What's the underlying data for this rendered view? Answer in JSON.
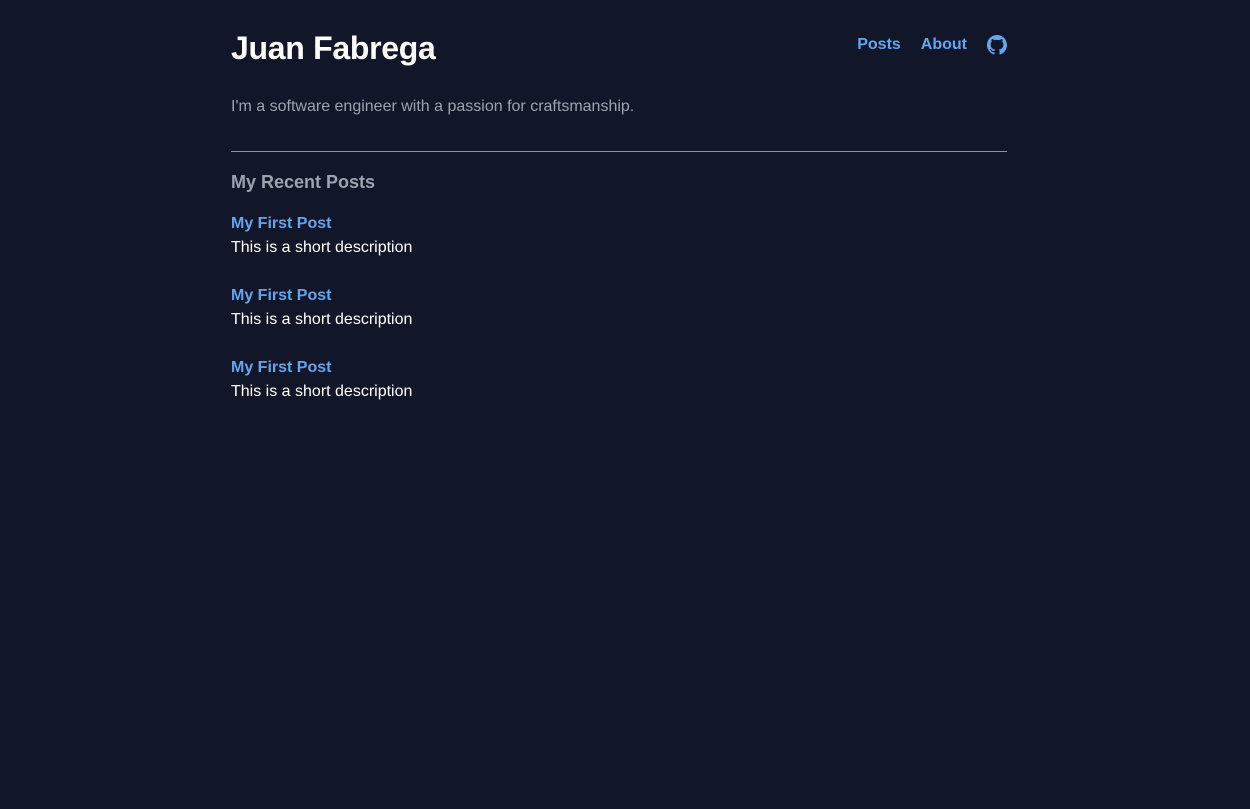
{
  "header": {
    "title": "Juan Fabrega",
    "nav": [
      {
        "label": "Posts"
      },
      {
        "label": "About"
      }
    ],
    "github_icon": "github-icon"
  },
  "intro": {
    "tagline": "I'm a software engineer with a passion for craftsmanship."
  },
  "recent_posts": {
    "heading": "My Recent Posts",
    "items": [
      {
        "title": "My First Post",
        "description": "This is a short description"
      },
      {
        "title": "My First Post",
        "description": "This is a short description"
      },
      {
        "title": "My First Post",
        "description": "This is a short description"
      }
    ]
  },
  "colors": {
    "background": "#111628",
    "link": "#63a6f0",
    "muted": "#9ca3af",
    "text": "#ffffff"
  }
}
